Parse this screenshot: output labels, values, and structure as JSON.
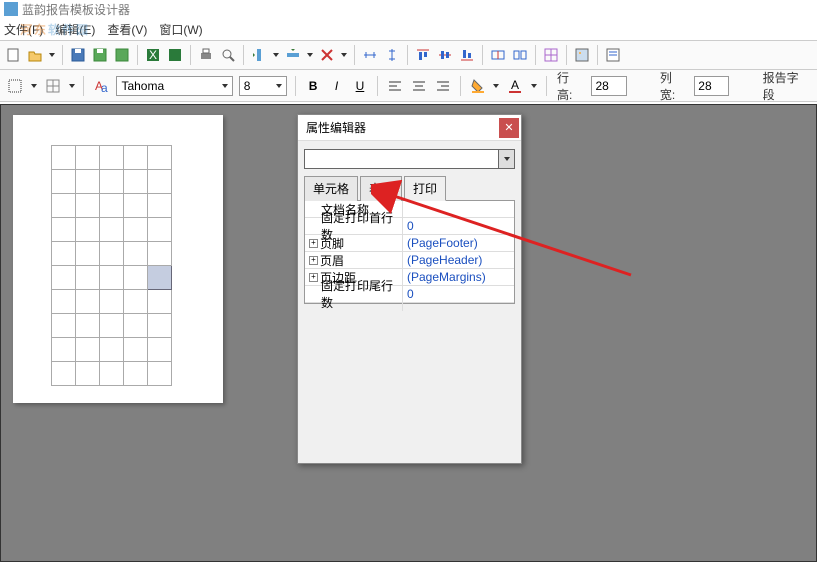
{
  "window": {
    "title": "蓝韵报告模板设计器"
  },
  "watermark": {
    "text1": "河东",
    "text2": "软件园"
  },
  "menu": {
    "file": "文件(F)",
    "edit": "编辑(E)",
    "view": "查看(V)",
    "window": "窗口(W)"
  },
  "toolbar2": {
    "font": "Tahoma",
    "size": "8",
    "lineH_label": "行高:",
    "lineH": "28",
    "colW_label": "列宽:",
    "colW": "28",
    "report_label": "报告字段"
  },
  "dialog": {
    "title": "属性编辑器",
    "tabs": {
      "cell": "单元格",
      "table": "表格",
      "print": "打印"
    },
    "props": {
      "docName": {
        "k": "文档名称",
        "v": ""
      },
      "fixedHead": {
        "k": "固定打印首行数",
        "v": "0"
      },
      "footer": {
        "k": "页脚",
        "v": "(PageFooter)"
      },
      "header": {
        "k": "页眉",
        "v": "(PageHeader)"
      },
      "margin": {
        "k": "页边距",
        "v": "(PageMargins)"
      },
      "fixedTail": {
        "k": "固定打印尾行数",
        "v": "0"
      }
    }
  }
}
